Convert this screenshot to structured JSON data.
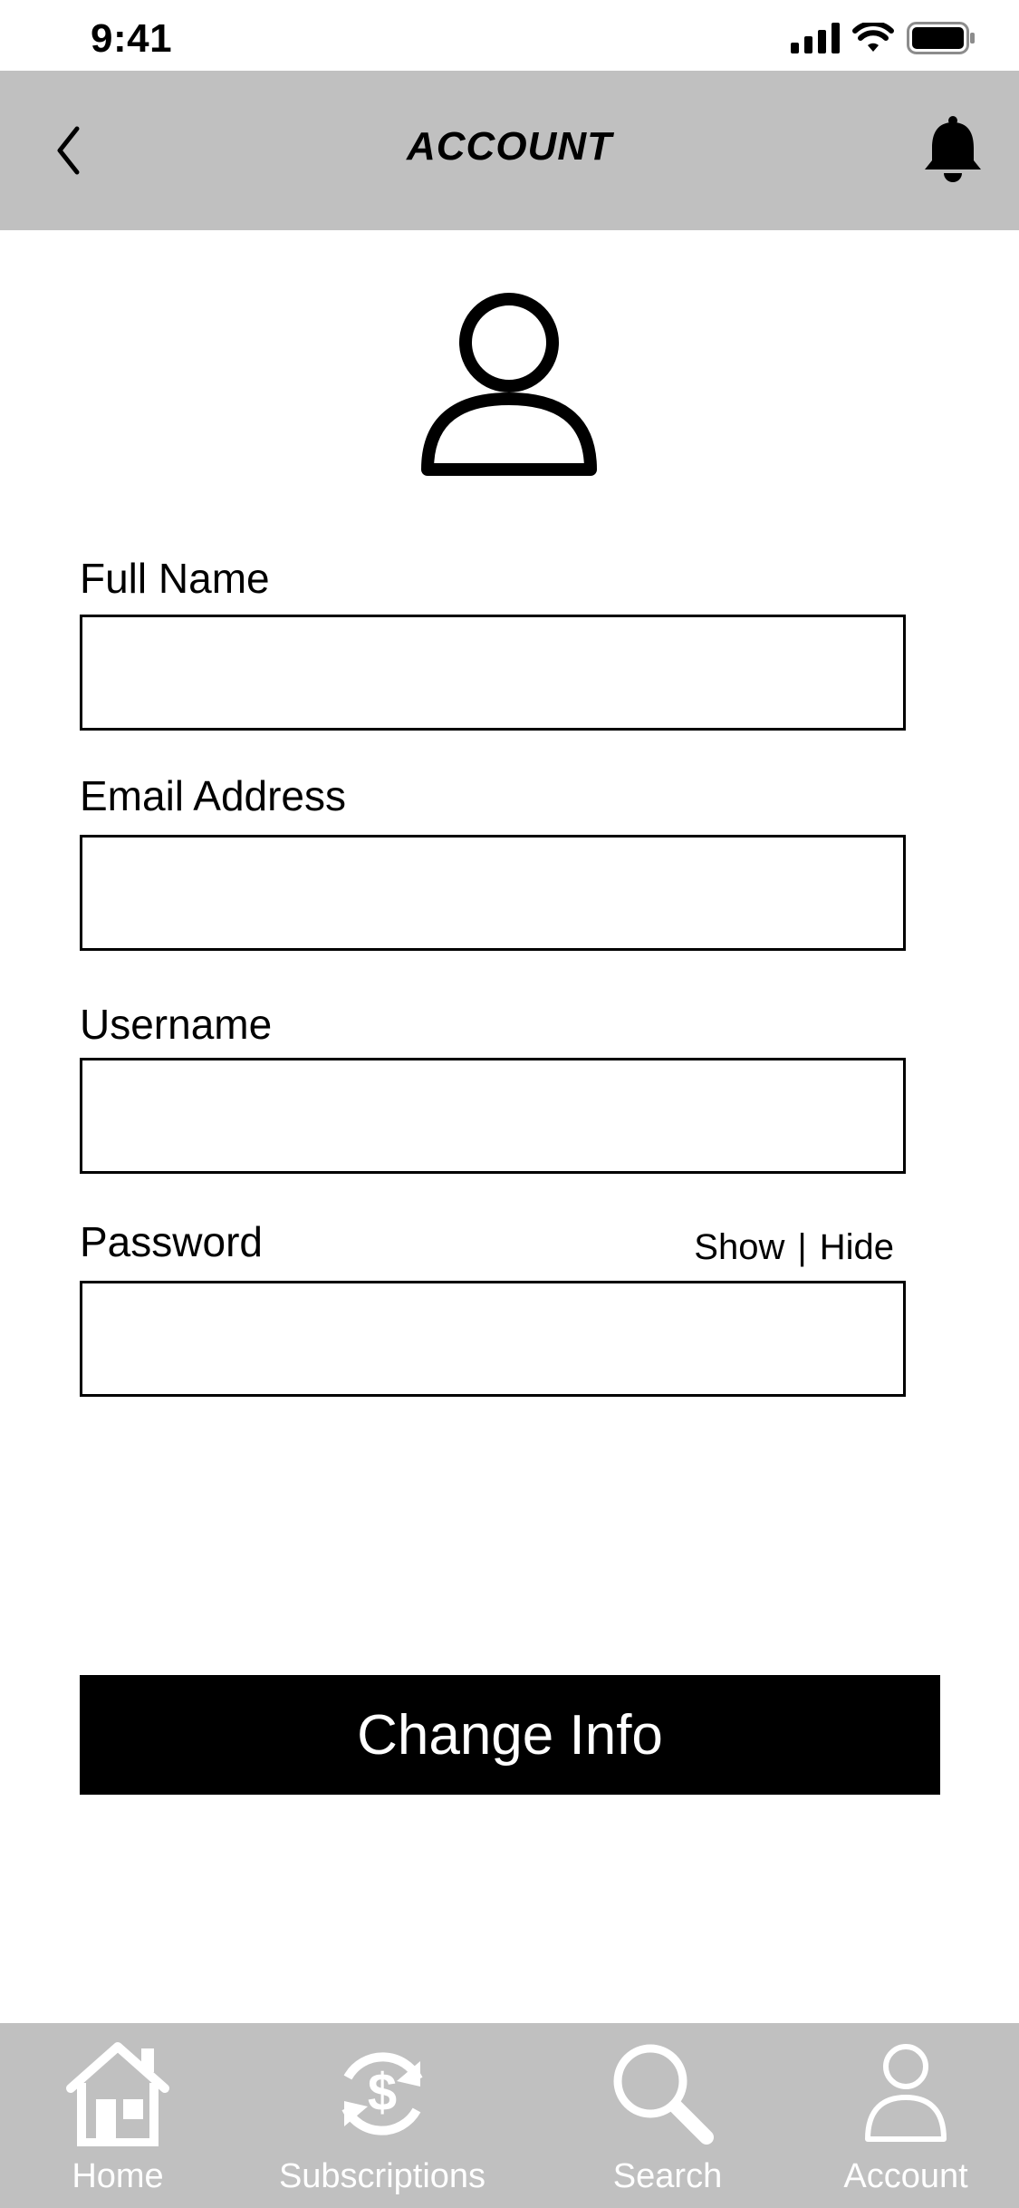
{
  "status_bar": {
    "time": "9:41"
  },
  "header": {
    "title": "ACCOUNT",
    "back_icon": "chevron-left-icon",
    "notification_icon": "bell-icon"
  },
  "avatar": {
    "icon": "user-icon"
  },
  "form": {
    "full_name": {
      "label": "Full Name",
      "value": "",
      "placeholder": ""
    },
    "email": {
      "label": "Email Address",
      "value": "",
      "placeholder": ""
    },
    "username": {
      "label": "Username",
      "value": "",
      "placeholder": ""
    },
    "password": {
      "label": "Password",
      "value": "",
      "placeholder": "",
      "show_label": "Show",
      "separator": "|",
      "hide_label": "Hide"
    },
    "submit_label": "Change Info"
  },
  "tab_bar": {
    "tabs": [
      {
        "label": "Home",
        "icon": "home-icon"
      },
      {
        "label": "Subscriptions",
        "icon": "subscriptions-icon"
      },
      {
        "label": "Search",
        "icon": "search-icon"
      },
      {
        "label": "Account",
        "icon": "user-icon"
      }
    ]
  },
  "colors": {
    "header_bg": "#c0c0c0",
    "tab_bar_bg": "#c0c0c0",
    "button_bg": "#000000",
    "button_text": "#ffffff",
    "tab_icon": "#ffffff"
  }
}
